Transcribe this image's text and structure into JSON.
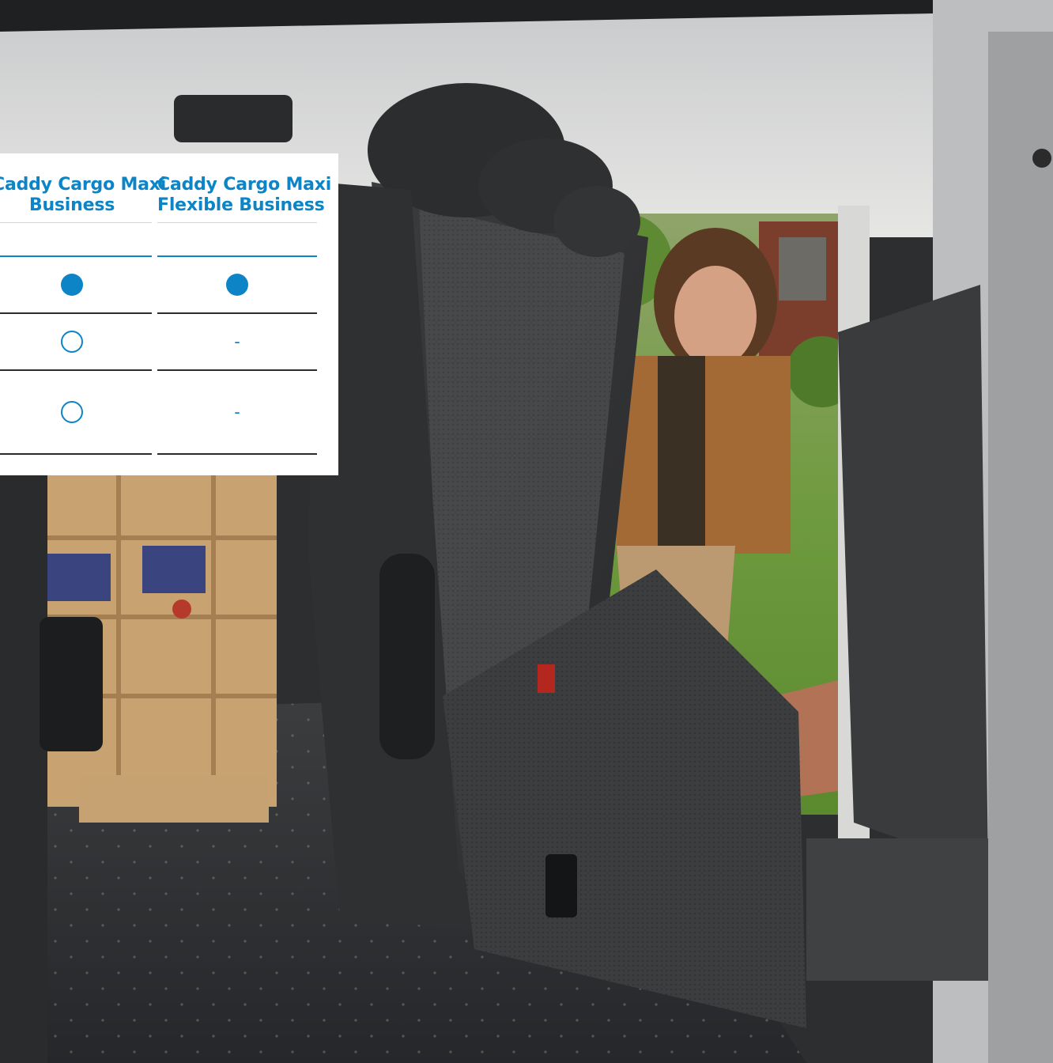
{
  "spec_table": {
    "columns": [
      {
        "title_line1": "Caddy Cargo Maxi",
        "title_line2": "Business",
        "rows": [
          {
            "type": "standard",
            "text": ""
          },
          {
            "type": "optional",
            "text": ""
          },
          {
            "type": "optional",
            "text": ""
          }
        ]
      },
      {
        "title_line1": "Caddy Cargo Maxi",
        "title_line2": "Flexible Business",
        "rows": [
          {
            "type": "standard",
            "text": ""
          },
          {
            "type": "not_available",
            "text": "-"
          },
          {
            "type": "not_available",
            "text": "-"
          }
        ]
      }
    ]
  },
  "colors": {
    "accent": "#0c84c6",
    "divider_dark": "#2b2b2b",
    "divider_light": "#d6d6d6"
  },
  "icons": {
    "standard": "filled-circle-icon",
    "optional": "outline-circle-icon"
  }
}
